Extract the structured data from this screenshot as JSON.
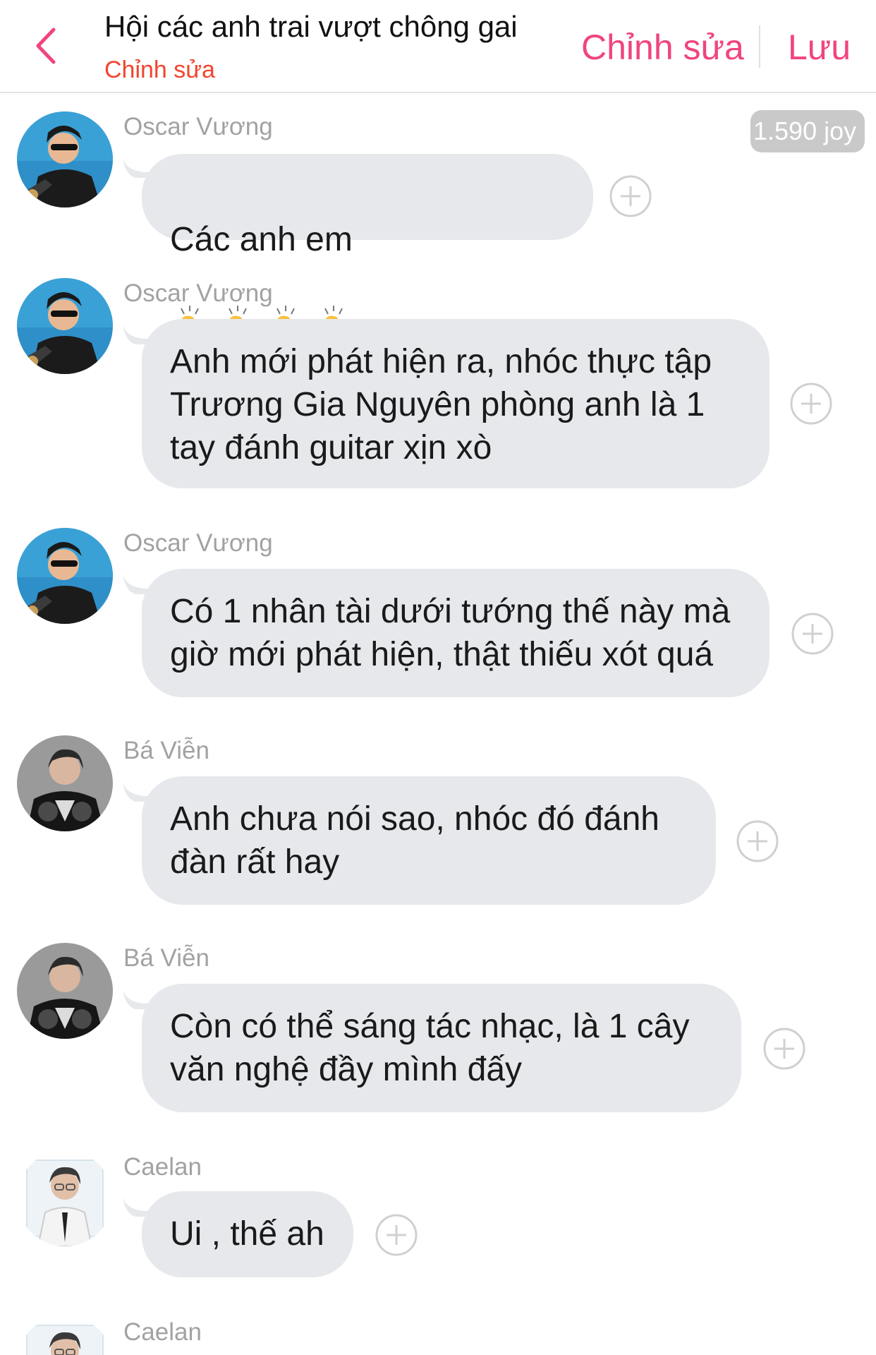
{
  "header": {
    "title": "Hội các anh trai vượt chông gai",
    "subtitle": "Chỉnh sửa",
    "edit_label": "Chỉnh sửa",
    "save_label": "Lưu",
    "accent_color": "#f0457f",
    "subtitle_color": "#f2442e"
  },
  "badge": {
    "label": "1.590 joy"
  },
  "messages": [
    {
      "sender": "Oscar Vương",
      "text": "Các anh em",
      "emoji": "clapping-hands x4"
    },
    {
      "sender": "Oscar Vương",
      "text": "Anh mới phát hiện ra, nhóc thực tập\nTrương Gia Nguyên phòng anh là 1\ntay đánh  guitar xịn xò"
    },
    {
      "sender": "Oscar Vương",
      "text": "Có 1 nhân tài dưới tướng thế này mà\ngiờ mới phát hiện, thật thiếu xót quá"
    },
    {
      "sender": "Bá Viễn",
      "text": "Anh chưa nói sao, nhóc đó đánh\nđàn rất hay"
    },
    {
      "sender": "Bá Viễn",
      "text": "Còn có thể sáng tác nhạc, là 1 cây\nvăn nghệ đầy mình đấy"
    },
    {
      "sender": "Caelan",
      "text": "Ui , thế ah"
    },
    {
      "sender": "Caelan"
    }
  ],
  "icons": {
    "back": "chevron-left-icon",
    "add_reaction": "plus-circle-icon",
    "emoji": "clapping-hands"
  }
}
